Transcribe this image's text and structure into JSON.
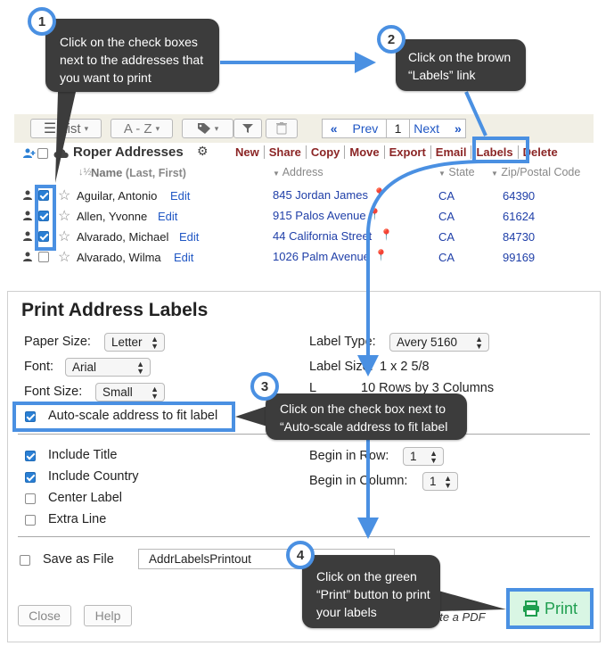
{
  "callouts": {
    "c1": {
      "number": "1",
      "text": "Click on the check boxes next to the addresses that you want to print"
    },
    "c2": {
      "number": "2",
      "text": "Click on the brown “Labels” link"
    },
    "c3": {
      "number": "3",
      "text": "Click on the check box next to “Auto-scale address to fit label"
    },
    "c4": {
      "number": "4",
      "text": "Click on the green “Print” button to print your labels"
    }
  },
  "toolbar": {
    "list_label": "List",
    "sort_label": "A - Z",
    "prev_label": "Prev",
    "page": "1",
    "next_label": "Next"
  },
  "address_book": {
    "title": "Roper Addresses",
    "actions": [
      "New",
      "Share",
      "Copy",
      "Move",
      "Export",
      "Email",
      "Labels",
      "Delete"
    ],
    "name_header": "Name",
    "name_hint": "(Last, First)",
    "columns": [
      "Address",
      "State",
      "Zip/Postal Code"
    ],
    "edit_label": "Edit",
    "rows": [
      {
        "name": "Aguilar, Antonio",
        "street": "845 Jordan James",
        "state": "CA",
        "zip": "64390",
        "checked": true
      },
      {
        "name": "Allen, Yvonne",
        "street": "915 Palos Avenue",
        "state": "CA",
        "zip": "61624",
        "checked": true
      },
      {
        "name": "Alvarado, Michael",
        "street": "44 California Street",
        "state": "CA",
        "zip": "84730",
        "checked": true
      },
      {
        "name": "Alvarado, Wilma",
        "street": "1026 Palm Avenue",
        "state": "CA",
        "zip": "99169",
        "checked": false
      }
    ]
  },
  "dialog": {
    "title": "Print Address Labels",
    "paper_size_label": "Paper Size:",
    "paper_size_value": "Letter",
    "font_label": "Font:",
    "font_value": "Arial",
    "font_size_label": "Font Size:",
    "font_size_value": "Small",
    "label_type_label": "Label Type:",
    "label_type_value": "Avery 5160",
    "label_size_label": "Label Size:",
    "label_size_value": "1 x 2 5/8",
    "layout_prefix": "L",
    "layout_value": "10 Rows by 3 Columns",
    "auto_scale_label": "Auto-scale address to fit label",
    "include_title_label": "Include Title",
    "include_country_label": "Include Country",
    "center_label_label": "Center Label",
    "extra_line_label": "Extra Line",
    "begin_row_label": "Begin in Row:",
    "begin_row_value": "1",
    "begin_column_label": "Begin in Column:",
    "begin_column_value": "1",
    "save_as_file_label": "Save as File",
    "filename_value": "AddrLabelsPrintout",
    "close_label": "Close",
    "help_label": "Help",
    "pdf_hint": "ate a PDF",
    "print_label": "Print"
  },
  "colors": {
    "accent": "#4a90e2",
    "callout_bg": "#3c3c3c",
    "link_brown": "#8b2525",
    "print_green": "#1e9e4f",
    "print_bg": "#d9f6e4"
  }
}
